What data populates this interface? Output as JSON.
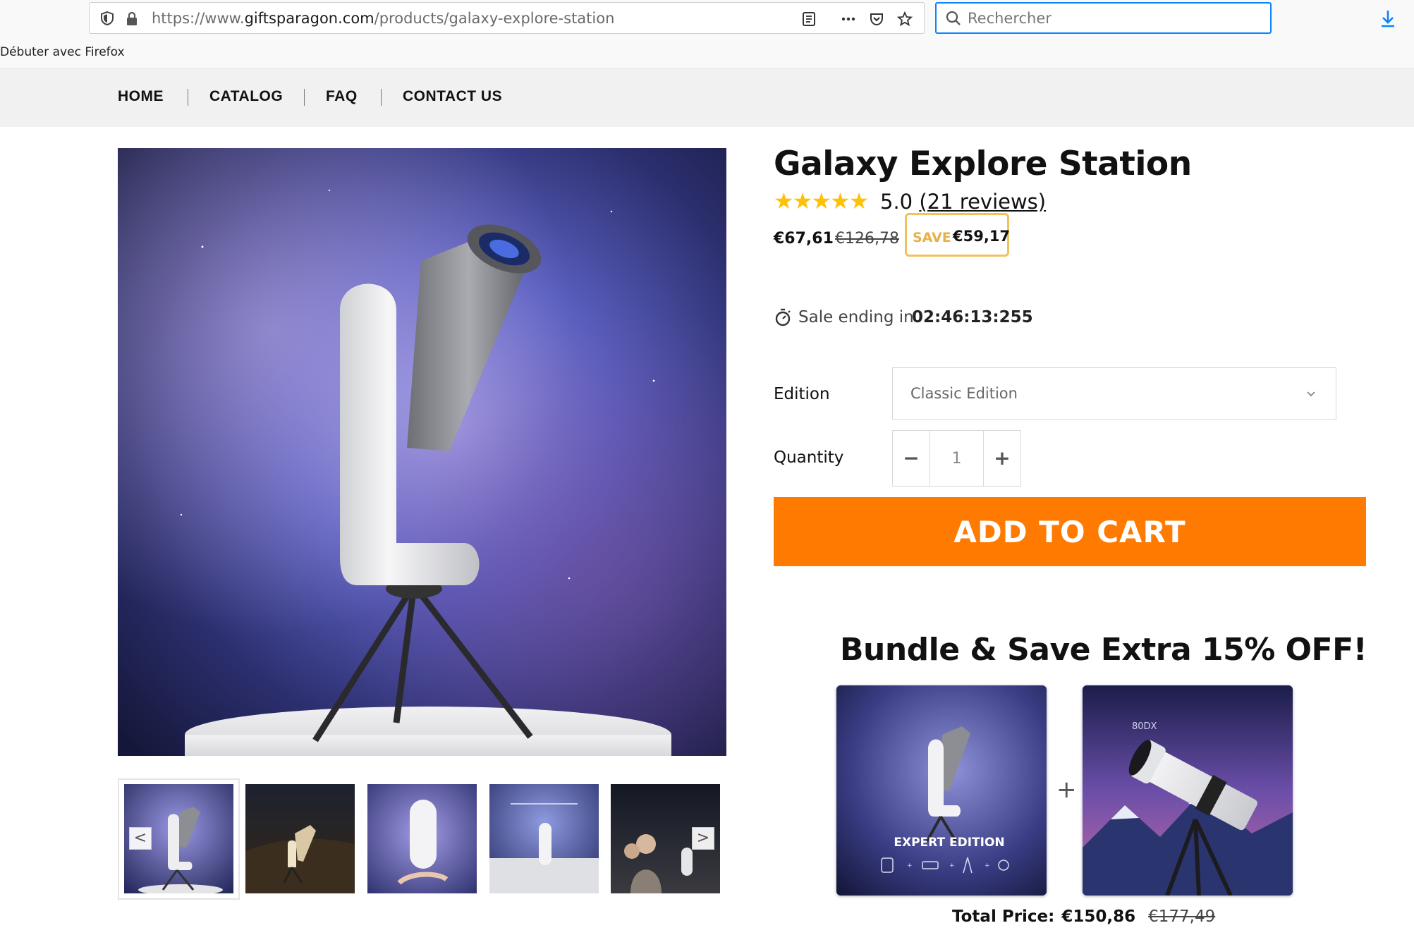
{
  "browser": {
    "url_prefix": "https://www.",
    "url_host": "giftsparagon.com",
    "url_path": "/products/galaxy-explore-station",
    "search_placeholder": "Rechercher",
    "bookmark": "Débuter avec Firefox"
  },
  "nav": {
    "items": [
      {
        "label": "HOME"
      },
      {
        "label": "CATALOG"
      },
      {
        "label": "FAQ"
      },
      {
        "label": "CONTACT US"
      }
    ]
  },
  "gallery": {
    "prev": "<",
    "next": ">"
  },
  "product": {
    "title": "Galaxy Explore Station",
    "rating": "5.0",
    "reviews": "(21 reviews)",
    "stars": 5,
    "price_sale": "€67,61",
    "price_old": "€126,78",
    "save_label": "SAVE",
    "save_amount": "€59,17",
    "timer_label": "Sale ending in",
    "timer_value": "02:46:13:255",
    "edition_label": "Edition",
    "edition_value": "Classic Edition",
    "quantity_label": "Quantity",
    "quantity_value": "1",
    "qty_minus": "−",
    "qty_plus": "+",
    "add_to_cart": "ADD TO CART"
  },
  "bundle": {
    "title": "Bundle & Save Extra 15% OFF!",
    "card1_caption": "EXPERT EDITION",
    "card2_caption": "80DX",
    "plus": "+",
    "total_label": "Total Price:",
    "total_price": "€150,86",
    "total_old": "€177,49"
  },
  "colors": {
    "accent": "#ff7a00",
    "star": "#ffc107",
    "save_border": "#f1c25c",
    "search_focus": "#0a84ff"
  }
}
